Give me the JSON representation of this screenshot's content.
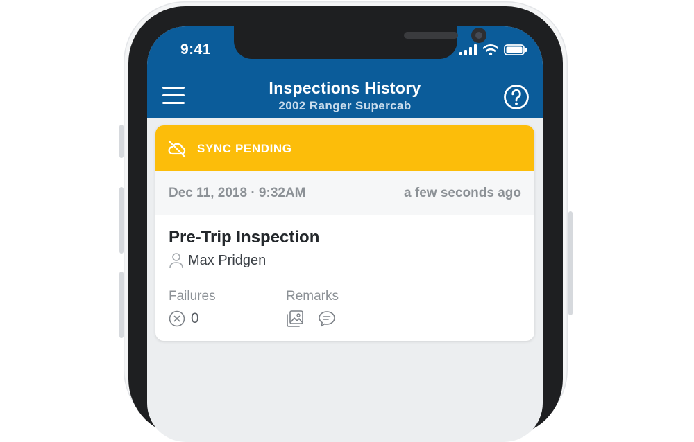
{
  "status_bar": {
    "time": "9:41"
  },
  "header": {
    "title": "Inspections History",
    "subtitle": "2002 Ranger Supercab",
    "menu_icon": "hamburger-menu-icon",
    "help_icon": "help-circle-icon",
    "background_color": "#0b5c9a"
  },
  "card": {
    "sync_banner": {
      "label": "SYNC PENDING",
      "icon": "cloud-off-icon",
      "color": "#fcbd0a"
    },
    "date": "Dec 11, 2018 · 9:32AM",
    "relative_time": "a few seconds ago",
    "inspection_type": "Pre-Trip Inspection",
    "user": "Max Pridgen",
    "failures": {
      "label": "Failures",
      "count": "0"
    },
    "remarks": {
      "label": "Remarks",
      "icons": [
        "photo-icon",
        "comment-icon"
      ]
    }
  }
}
